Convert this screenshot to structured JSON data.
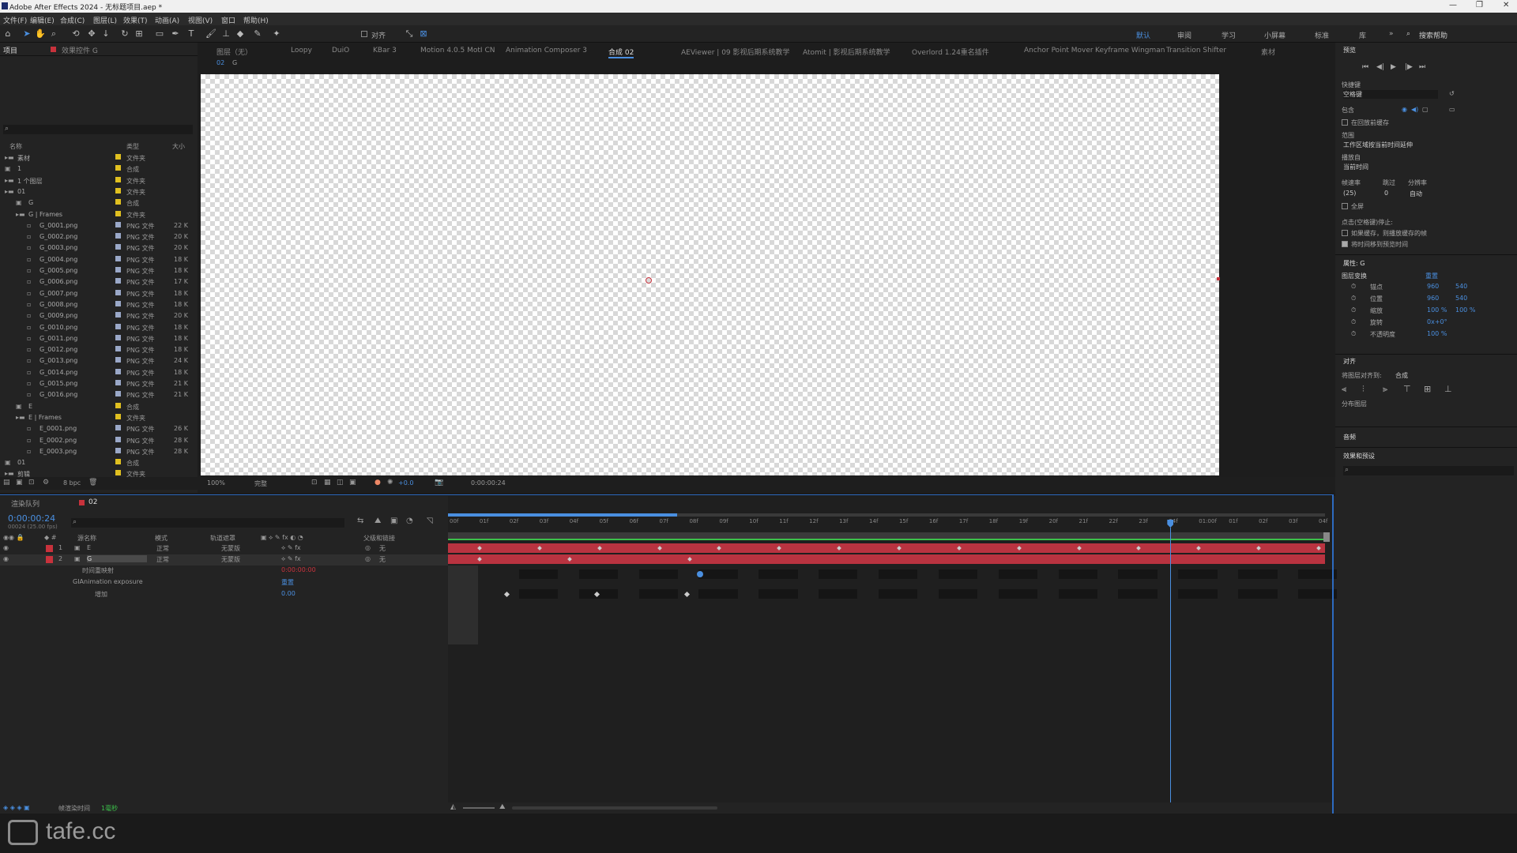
{
  "app": {
    "title": "Adobe After Effects 2024 - 无标题项目.aep *",
    "window_controls": [
      "—",
      "❐",
      "✕"
    ]
  },
  "menu": [
    "文件(F)",
    "编辑(E)",
    "合成(C)",
    "图层(L)",
    "效果(T)",
    "动画(A)",
    "视图(V)",
    "窗口",
    "帮助(H)"
  ],
  "toolbar": {
    "align_label": "对齐",
    "workspaces": [
      "默认",
      "审阅",
      "学习",
      "小屏幕",
      "标准",
      "库"
    ],
    "search_help": "搜索帮助"
  },
  "project_panel": {
    "tab": "项目",
    "effects_tab": "效果控件 G",
    "headers": {
      "name": "名称",
      "type": "类型",
      "size": "大小"
    },
    "rows": [
      {
        "name": "素材",
        "type": "文件夹",
        "size": "",
        "color": "#e0c020",
        "indent": 0
      },
      {
        "name": "1",
        "type": "合成",
        "size": "",
        "color": "#e0c020",
        "indent": 0
      },
      {
        "name": "1 个图层",
        "type": "文件夹",
        "size": "",
        "color": "#e0c020",
        "indent": 0
      },
      {
        "name": "01",
        "type": "文件夹",
        "size": "",
        "color": "#e0c020",
        "indent": 0
      },
      {
        "name": "G",
        "type": "合成",
        "size": "",
        "color": "#e0c020",
        "indent": 1
      },
      {
        "name": "G | Frames",
        "type": "文件夹",
        "size": "",
        "color": "#e0c020",
        "indent": 1
      },
      {
        "name": "G_0001.png",
        "type": "PNG 文件",
        "size": "22 K",
        "color": "#9aa8c8",
        "indent": 2
      },
      {
        "name": "G_0002.png",
        "type": "PNG 文件",
        "size": "20 K",
        "color": "#9aa8c8",
        "indent": 2
      },
      {
        "name": "G_0003.png",
        "type": "PNG 文件",
        "size": "20 K",
        "color": "#9aa8c8",
        "indent": 2
      },
      {
        "name": "G_0004.png",
        "type": "PNG 文件",
        "size": "18 K",
        "color": "#9aa8c8",
        "indent": 2
      },
      {
        "name": "G_0005.png",
        "type": "PNG 文件",
        "size": "18 K",
        "color": "#9aa8c8",
        "indent": 2
      },
      {
        "name": "G_0006.png",
        "type": "PNG 文件",
        "size": "17 K",
        "color": "#9aa8c8",
        "indent": 2
      },
      {
        "name": "G_0007.png",
        "type": "PNG 文件",
        "size": "18 K",
        "color": "#9aa8c8",
        "indent": 2
      },
      {
        "name": "G_0008.png",
        "type": "PNG 文件",
        "size": "18 K",
        "color": "#9aa8c8",
        "indent": 2
      },
      {
        "name": "G_0009.png",
        "type": "PNG 文件",
        "size": "20 K",
        "color": "#9aa8c8",
        "indent": 2
      },
      {
        "name": "G_0010.png",
        "type": "PNG 文件",
        "size": "18 K",
        "color": "#9aa8c8",
        "indent": 2
      },
      {
        "name": "G_0011.png",
        "type": "PNG 文件",
        "size": "18 K",
        "color": "#9aa8c8",
        "indent": 2
      },
      {
        "name": "G_0012.png",
        "type": "PNG 文件",
        "size": "18 K",
        "color": "#9aa8c8",
        "indent": 2
      },
      {
        "name": "G_0013.png",
        "type": "PNG 文件",
        "size": "24 K",
        "color": "#9aa8c8",
        "indent": 2
      },
      {
        "name": "G_0014.png",
        "type": "PNG 文件",
        "size": "18 K",
        "color": "#9aa8c8",
        "indent": 2
      },
      {
        "name": "G_0015.png",
        "type": "PNG 文件",
        "size": "21 K",
        "color": "#9aa8c8",
        "indent": 2
      },
      {
        "name": "G_0016.png",
        "type": "PNG 文件",
        "size": "21 K",
        "color": "#9aa8c8",
        "indent": 2
      },
      {
        "name": "E",
        "type": "合成",
        "size": "",
        "color": "#e0c020",
        "indent": 1
      },
      {
        "name": "E | Frames",
        "type": "文件夹",
        "size": "",
        "color": "#e0c020",
        "indent": 1
      },
      {
        "name": "E_0001.png",
        "type": "PNG 文件",
        "size": "26 K",
        "color": "#9aa8c8",
        "indent": 2
      },
      {
        "name": "E_0002.png",
        "type": "PNG 文件",
        "size": "28 K",
        "color": "#9aa8c8",
        "indent": 2
      },
      {
        "name": "E_0003.png",
        "type": "PNG 文件",
        "size": "28 K",
        "color": "#9aa8c8",
        "indent": 2
      },
      {
        "name": "01",
        "type": "合成",
        "size": "",
        "color": "#e0c020",
        "indent": 0
      },
      {
        "name": "剪辑",
        "type": "文件夹",
        "size": "",
        "color": "#e0c020",
        "indent": 0
      }
    ],
    "bpc": "8 bpc"
  },
  "viewer": {
    "tabs": [
      "图层（无）",
      "Loopy",
      "DuiO",
      "KBar 3",
      "Motion 4.0.5 MotI CN",
      "Animation Composer 3",
      "合成 02",
      "AEViewer | 09 影视后期系统教学",
      "Atomit | 影视后期系统教学",
      "Overlord 1.24重名插件",
      "Anchor Point Mover",
      "Keyframe Wingman",
      "Transition Shifter",
      "素材"
    ],
    "breadcrumb": [
      "02",
      "G"
    ],
    "zoom": "100%",
    "resolution": "完整",
    "exposure": "+0.0",
    "timecode": "0:00:00:24"
  },
  "preview": {
    "title": "预览",
    "shortcut_label": "快捷键",
    "shortcut_value": "空格键",
    "include_label": "包含",
    "cache_before": "在回放前缓存",
    "range_label": "范围",
    "range_value": "工作区域按当前时间延伸",
    "playfrom_label": "播放自",
    "playfrom_value": "当前时间",
    "fps_label": "帧速率",
    "skip_label": "跳过",
    "res_label": "分辨率",
    "fps_value": "(25)",
    "skip_value": "0",
    "res_value": "自动",
    "fullscreen": "全屏",
    "stop_label": "点击(空格键)停止:",
    "stop_opt1": "如果缓存，则播放缓存的帧",
    "stop_opt2": "将时间移到预览时间"
  },
  "properties": {
    "title": "属性: G",
    "section": "图层变换",
    "reset": "重置",
    "rows": [
      {
        "label": "锚点",
        "v1": "960",
        "v2": "540"
      },
      {
        "label": "位置",
        "v1": "960",
        "v2": "540"
      },
      {
        "label": "缩放",
        "v1": "100 %",
        "v2": "100 %"
      },
      {
        "label": "旋转",
        "v1": "0x+0°",
        "v2": ""
      },
      {
        "label": "不透明度",
        "v1": "100 %",
        "v2": ""
      }
    ]
  },
  "align": {
    "title": "对齐",
    "align_to_label": "将图层对齐到:",
    "align_to_value": "合成",
    "distribute": "分布图层"
  },
  "audio": {
    "title": "音频"
  },
  "effects": {
    "title": "效果和预设"
  },
  "timeline": {
    "tabs": [
      "渲染队列",
      "02"
    ],
    "current_time": "0:00:00:24",
    "current_frames": "00024 (25.00 fps)",
    "col_headers": {
      "name": "源名称",
      "mode": "模式",
      "trkmat": "轨道遮罩",
      "parent": "父级和链接"
    },
    "layers": [
      {
        "num": "1",
        "name": "E",
        "mode": "正常",
        "trkmat": "无蒙版",
        "parent": "无",
        "color": "#c8323c"
      },
      {
        "num": "2",
        "name": "G",
        "mode": "正常",
        "trkmat": "无蒙版",
        "parent": "无",
        "color": "#c8323c"
      }
    ],
    "sub_rows": [
      {
        "label": "时间重映射",
        "value": "0:00:00:00"
      },
      {
        "label": "GIAnimation exposure",
        "value": "重置"
      },
      {
        "label": "增加",
        "value": "0.00"
      }
    ],
    "ruler": [
      "00f",
      "01f",
      "02f",
      "03f",
      "04f",
      "05f",
      "06f",
      "07f",
      "08f",
      "09f",
      "10f",
      "11f",
      "12f",
      "13f",
      "14f",
      "15f",
      "16f",
      "17f",
      "18f",
      "19f",
      "20f",
      "21f",
      "22f",
      "23f",
      "24f",
      "01:00f",
      "01f",
      "02f",
      "03f",
      "04f"
    ],
    "playhead_frame": 24,
    "render_time_label": "帧渲染时间",
    "render_time_value": "1毫秒"
  },
  "watermark": "tafe.cc"
}
